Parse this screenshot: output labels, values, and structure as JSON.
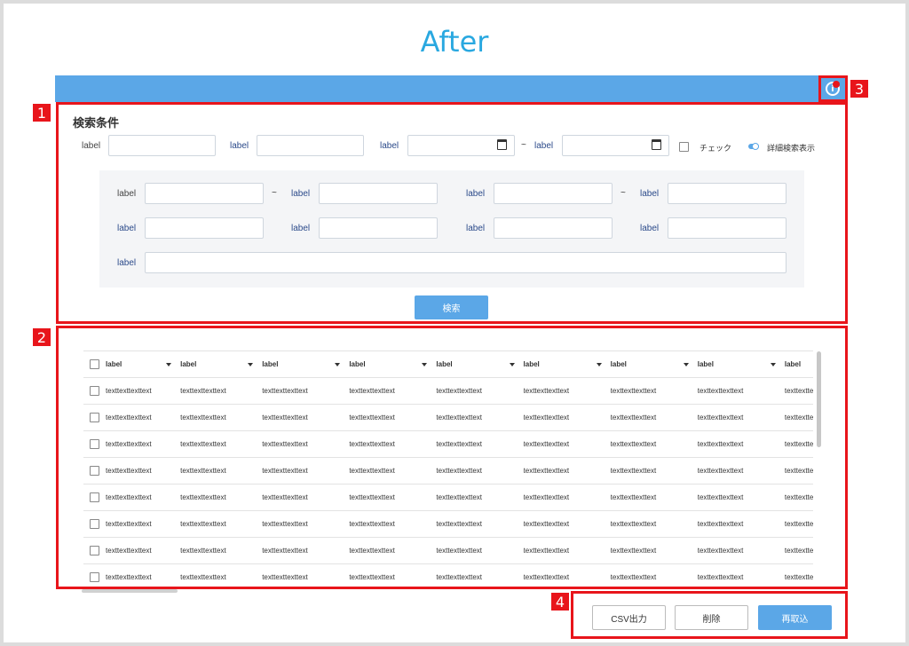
{
  "page_title": "After",
  "search": {
    "title": "検索条件",
    "label": "label",
    "tilde": "~",
    "check_label": "チェック",
    "toggle_label": "詳細検索表示",
    "search_button": "検索"
  },
  "table": {
    "headers": [
      "label",
      "label",
      "label",
      "label",
      "label",
      "label",
      "label",
      "label",
      "label"
    ],
    "cell_text": "texttexttexttext",
    "row_count": 8
  },
  "actions": {
    "csv": "CSV出力",
    "delete": "削除",
    "reimport": "再取込"
  },
  "markers": [
    "1",
    "2",
    "3",
    "4"
  ],
  "colors": {
    "accent": "#5ba7e7",
    "highlight": "#e8151b",
    "title": "#29a8e0"
  },
  "icons": {
    "info": "info-icon",
    "calendar": "calendar-icon",
    "sort": "caret-down-icon"
  }
}
